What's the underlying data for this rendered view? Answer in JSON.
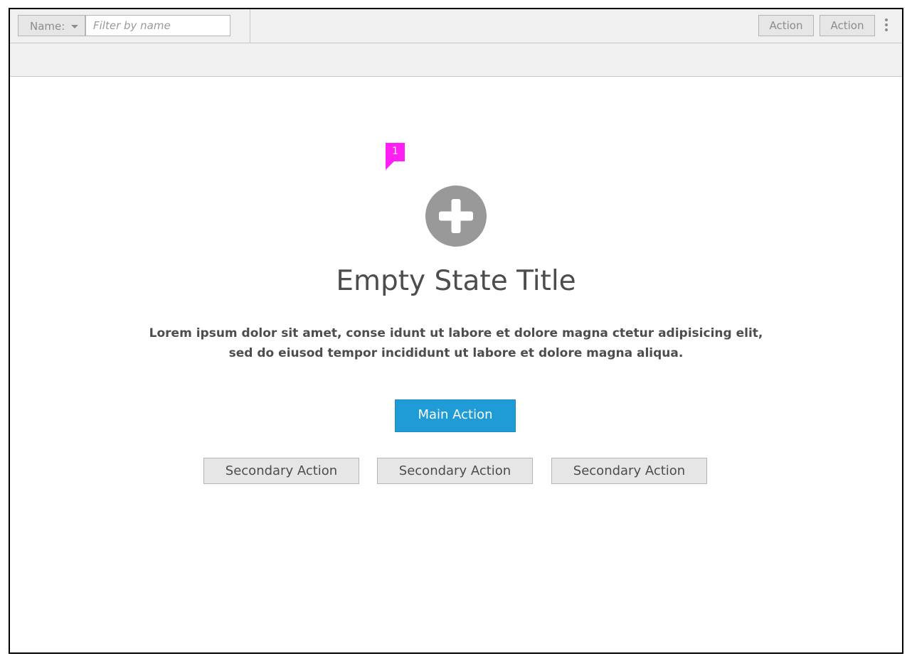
{
  "toolbar": {
    "filter_select_label": "Name:",
    "filter_placeholder": "Filter by name",
    "filter_value": "",
    "actions": [
      "Action",
      "Action"
    ],
    "kebab_icon": "kebab-menu-icon"
  },
  "annotation": {
    "marker_number": "1",
    "marker_color": "#ff1ff5"
  },
  "empty_state": {
    "icon": "add-circle-icon",
    "icon_color": "#999999",
    "title": "Empty State Title",
    "description": "Lorem ipsum dolor sit amet, conse idunt ut labore et dolore magna ctetur adipisicing elit, sed do eiusod tempor incididunt ut labore et dolore magna aliqua.",
    "main_action": "Main Action",
    "main_action_color": "#1f9bd6",
    "secondary_actions": [
      "Secondary Action",
      "Secondary Action",
      "Secondary Action"
    ]
  }
}
